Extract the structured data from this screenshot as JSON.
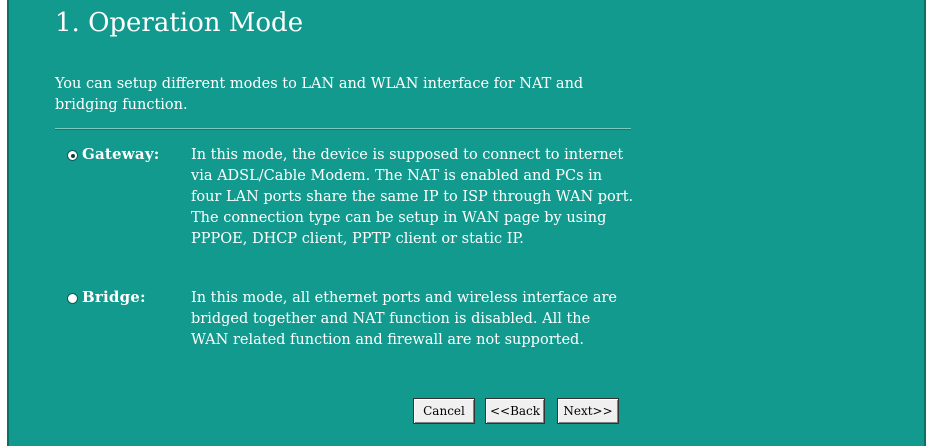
{
  "page": {
    "title": "1. Operation Mode",
    "intro_line1": "You can setup different modes to LAN and WLAN interface for NAT and",
    "intro_line2": "bridging function."
  },
  "modes": [
    {
      "label": "Gateway:",
      "selected": true,
      "description": [
        "In this mode, the device is supposed to connect to internet",
        "via ADSL/Cable Modem. The NAT is enabled and PCs in",
        "four LAN ports share the same IP to ISP through WAN port.",
        "The connection type can be setup in WAN page by using",
        "PPPOE, DHCP client, PPTP client or static IP."
      ]
    },
    {
      "label": "Bridge:",
      "selected": false,
      "description": [
        "In this mode, all ethernet ports and wireless interface are",
        "bridged together and NAT function is disabled. All the",
        "WAN related function and firewall are not supported."
      ]
    }
  ],
  "buttons": {
    "cancel": "Cancel",
    "back": "<<Back",
    "next": "Next>>"
  },
  "colors": {
    "panel_background": "#129a8e",
    "text": "#ffffff"
  }
}
